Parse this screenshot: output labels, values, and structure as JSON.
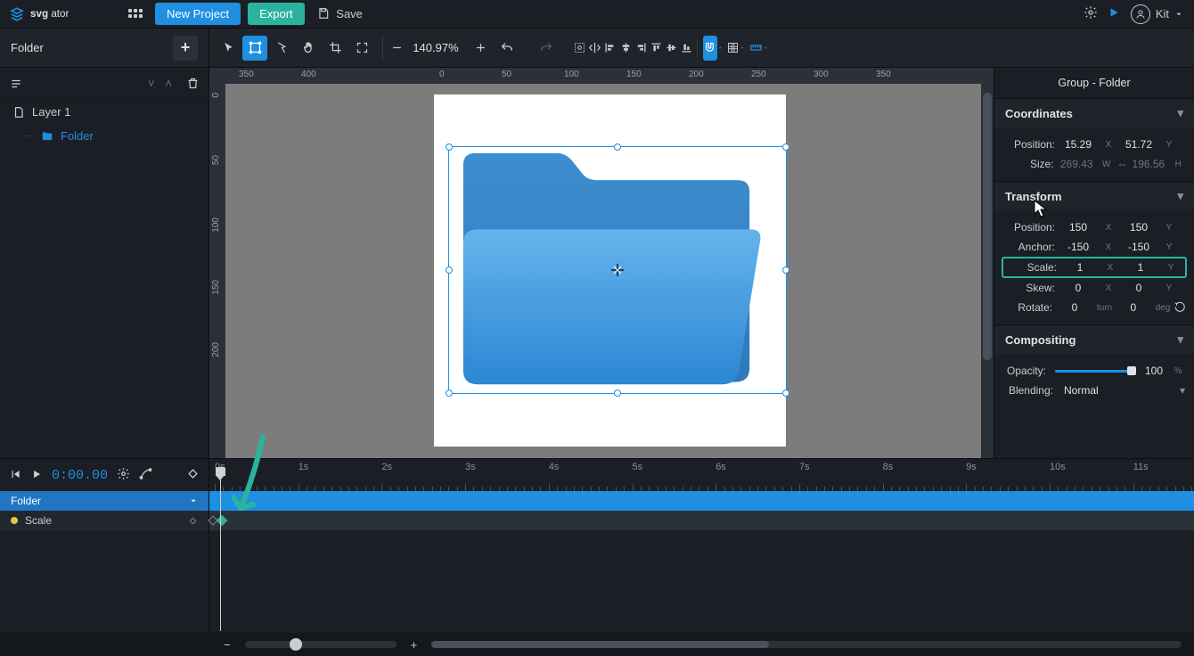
{
  "app": {
    "name": "svgator",
    "user": "Kit"
  },
  "topbar": {
    "new_project": "New Project",
    "export": "Export",
    "save": "Save"
  },
  "project": {
    "folder_label": "Folder"
  },
  "layers": {
    "layer1_label": "Layer 1",
    "folder_label": "Folder"
  },
  "zoom": {
    "value": "140.97%"
  },
  "ruler_h": [
    "350",
    "400",
    "0",
    "50",
    "100",
    "150",
    "200",
    "250",
    "300",
    "350"
  ],
  "ruler_v": [
    "0",
    "50",
    "100",
    "150",
    "200"
  ],
  "right_panel": {
    "title": "Group - Folder",
    "coords_title": "Coordinates",
    "coords": {
      "pos_lbl": "Position:",
      "pos_x": "15.29",
      "pos_y": "51.72",
      "size_lbl": "Size:",
      "size_w": "269.43",
      "size_h": "196.56"
    },
    "transform_title": "Transform",
    "transform": {
      "pos_lbl": "Position:",
      "pos_x": "150",
      "pos_y": "150",
      "anchor_lbl": "Anchor:",
      "anchor_x": "-150",
      "anchor_y": "-150",
      "scale_lbl": "Scale:",
      "scale_x": "1",
      "scale_y": "1",
      "skew_lbl": "Skew:",
      "skew_x": "0",
      "skew_y": "0",
      "rotate_lbl": "Rotate:",
      "rotate_t": "0",
      "rotate_d": "0",
      "rotate_u1": "turn",
      "rotate_u2": "deg"
    },
    "comp_title": "Compositing",
    "comp": {
      "opacity_lbl": "Opacity:",
      "opacity_v": "100",
      "blend_lbl": "Blending:",
      "blend_v": "Normal"
    }
  },
  "timeline": {
    "time": "0:00.00",
    "seconds": [
      "0s",
      "1s",
      "2s",
      "3s",
      "4s",
      "5s",
      "6s",
      "7s",
      "8s",
      "9s",
      "10s",
      "11s"
    ],
    "tracks": {
      "folder": "Folder",
      "scale": "Scale"
    }
  }
}
